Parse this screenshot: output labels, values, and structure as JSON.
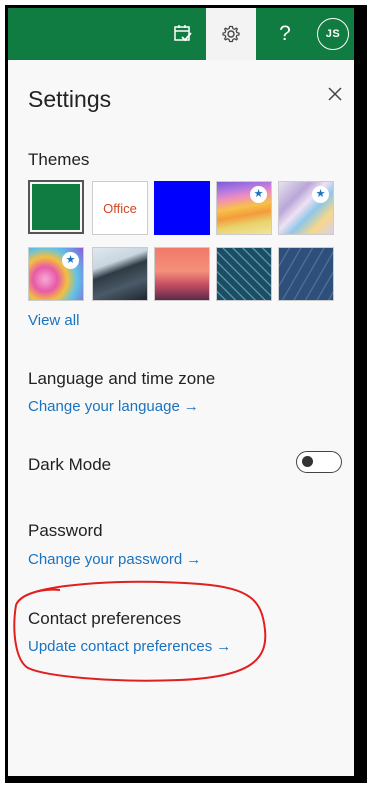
{
  "topbar": {
    "icons": [
      "calendar-check-icon",
      "gear-icon",
      "help-icon"
    ],
    "help_glyph": "?",
    "avatar_initials": "JS",
    "color": "#107c41"
  },
  "panel": {
    "title": "Settings",
    "close_icon": "close-icon"
  },
  "themes": {
    "heading": "Themes",
    "view_all": "View all",
    "items": [
      {
        "name": "green",
        "selected": true,
        "color": "#107c41"
      },
      {
        "name": "office",
        "label": "Office"
      },
      {
        "name": "blue",
        "color": "#0000ff"
      },
      {
        "name": "rainbow-stripes",
        "star": true
      },
      {
        "name": "pastel-ribbons",
        "star": true
      },
      {
        "name": "unicorn",
        "star": true
      },
      {
        "name": "mountain"
      },
      {
        "name": "palm-sunset"
      },
      {
        "name": "circuit"
      },
      {
        "name": "blueprint"
      }
    ]
  },
  "language": {
    "heading": "Language and time zone",
    "link": "Change your language"
  },
  "dark_mode": {
    "heading": "Dark Mode",
    "enabled": false
  },
  "password": {
    "heading": "Password",
    "link": "Change your password"
  },
  "contact": {
    "heading": "Contact preferences",
    "link": "Update contact preferences"
  },
  "link_arrow": "→",
  "colors": {
    "link": "#1a73c0",
    "annotation": "#e02020"
  }
}
